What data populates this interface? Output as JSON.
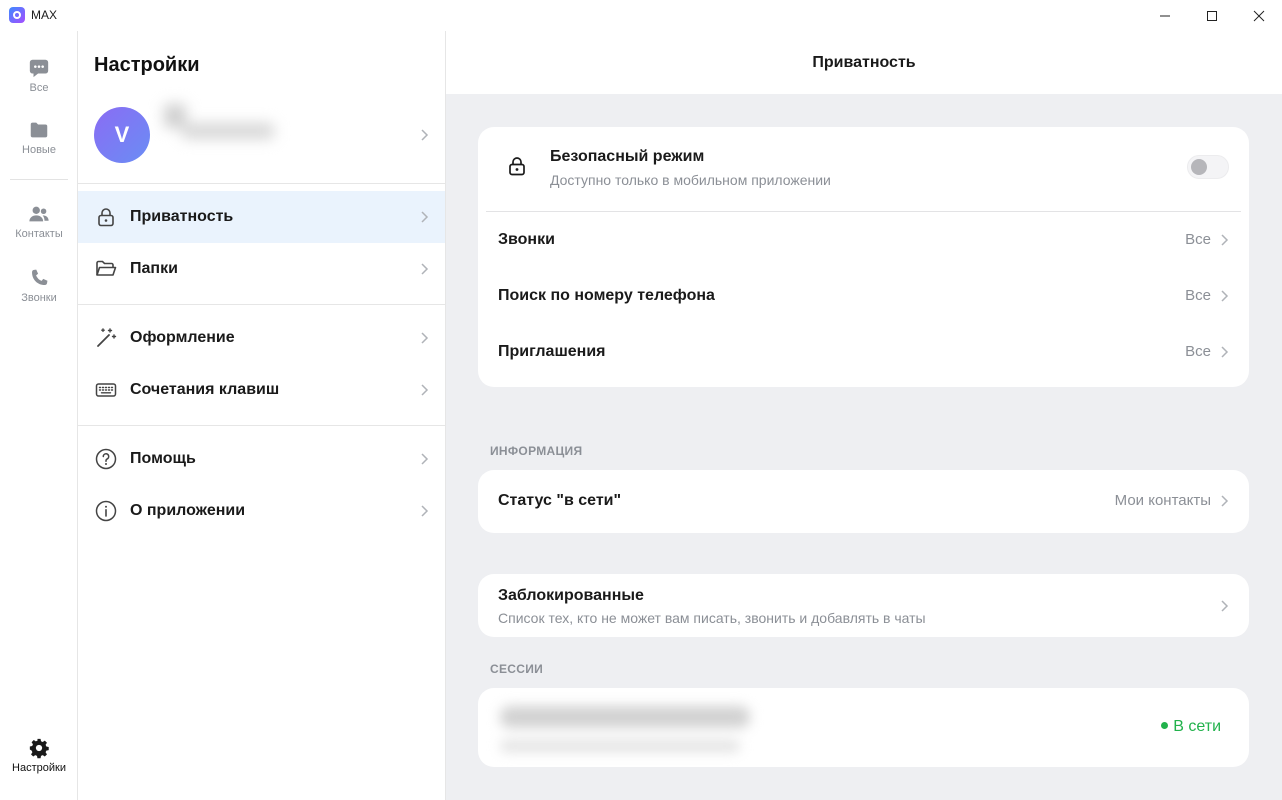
{
  "window": {
    "title": "MAX"
  },
  "rail": {
    "items": [
      {
        "label": "Все",
        "icon": "chat-bubble-icon"
      },
      {
        "label": "Новые",
        "icon": "folder-icon"
      },
      {
        "label": "Контакты",
        "icon": "contacts-icon"
      },
      {
        "label": "Звонки",
        "icon": "phone-icon"
      }
    ],
    "settings": {
      "label": "Настройки",
      "icon": "gear-icon"
    }
  },
  "settings": {
    "title": "Настройки",
    "profile": {
      "avatar_letter": "V"
    },
    "menu": [
      {
        "label": "Приватность",
        "icon": "lock-icon",
        "active": true
      },
      {
        "label": "Папки",
        "icon": "folder-open-icon"
      },
      {
        "label": "Оформление",
        "icon": "magic-wand-icon"
      },
      {
        "label": "Сочетания клавиш",
        "icon": "keyboard-icon"
      },
      {
        "label": "Помощь",
        "icon": "help-icon"
      },
      {
        "label": "О приложении",
        "icon": "info-icon"
      }
    ]
  },
  "privacy": {
    "header": "Приватность",
    "safe_mode": {
      "title": "Безопасный режим",
      "subtitle": "Доступно только в мобильном приложении",
      "enabled": false
    },
    "rows": [
      {
        "label": "Звонки",
        "value": "Все"
      },
      {
        "label": "Поиск по номеру телефона",
        "value": "Все"
      },
      {
        "label": "Приглашения",
        "value": "Все"
      }
    ],
    "info_section": {
      "title": "ИНФОРМАЦИЯ",
      "online_status": {
        "label": "Статус \"в сети\"",
        "value": "Мои контакты"
      }
    },
    "blocked": {
      "title": "Заблокированные",
      "subtitle": "Список тех, кто не может вам писать, звонить и добавлять в чаты"
    },
    "sessions_section": {
      "title": "СЕССИИ",
      "status": "В сети",
      "status_color": "#22b24c"
    }
  },
  "colors": {
    "active_item_bg": "#eaf3fd",
    "background": "#eeeff2",
    "muted_text": "#8b8f96"
  }
}
